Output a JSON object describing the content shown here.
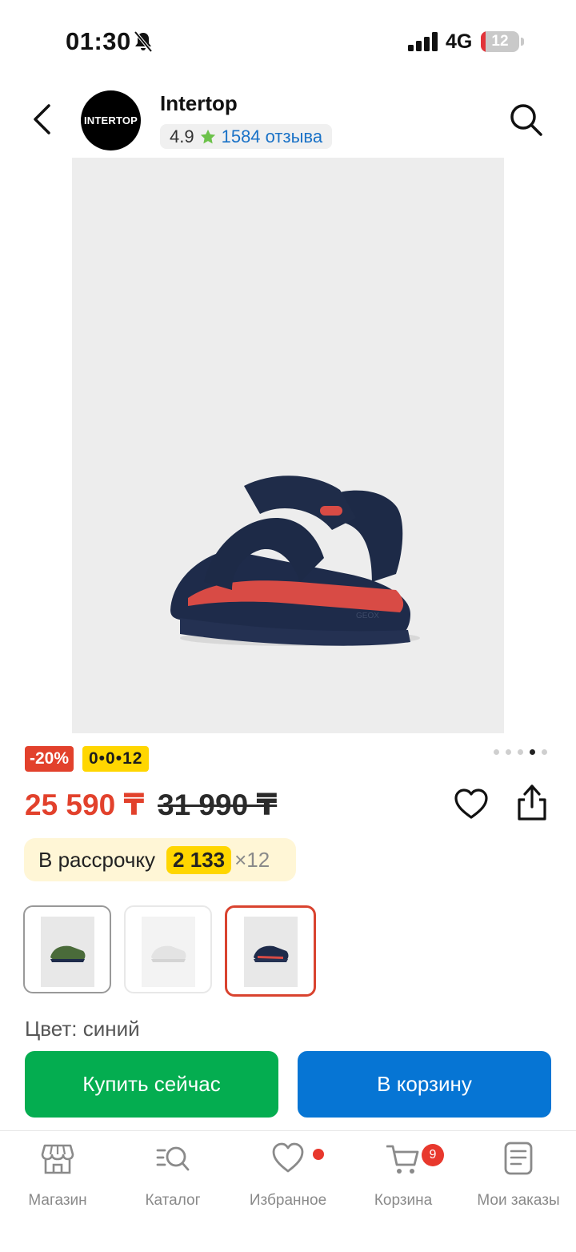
{
  "status_bar": {
    "time": "01:30",
    "network": "4G",
    "battery_level": "12",
    "battery_fraction": 0.12,
    "icons": [
      "bell-muted-icon",
      "signal-icon",
      "battery-icon"
    ]
  },
  "header": {
    "logo_text": "INTERTOP",
    "store_name": "Intertop",
    "rating": "4.9",
    "reviews": "1584 отзыва",
    "icons": [
      "back-arrow-icon",
      "star-icon",
      "search-icon"
    ]
  },
  "gallery": {
    "image_count": 5,
    "active_index": 3
  },
  "badges": {
    "discount": "-20%",
    "installment_plan": "0•0•12"
  },
  "price": {
    "current": "25 590 ₸",
    "old": "31 990 ₸"
  },
  "installment": {
    "label": "В рассрочку",
    "amount": "2 133",
    "multiplier": "×12"
  },
  "variants": {
    "colors": [
      "green",
      "white",
      "navy"
    ],
    "selected_index": 2
  },
  "color_label": "Цвет: синий",
  "actions": {
    "buy_now": "Купить сейчас",
    "add_to_cart": "В корзину"
  },
  "tabs": [
    {
      "label": "Магазин",
      "icon": "store-icon"
    },
    {
      "label": "Каталог",
      "icon": "catalog-search-icon"
    },
    {
      "label": "Избранное",
      "icon": "heart-icon"
    },
    {
      "label": "Корзина",
      "icon": "cart-icon",
      "badge": "9"
    },
    {
      "label": "Мои заказы",
      "icon": "orders-icon"
    }
  ],
  "colors": {
    "price_red": "#e2412c",
    "buy_green": "#04ad50",
    "cart_blue": "#0675d4",
    "link_blue": "#1a72c7",
    "installment_yellow": "#ffd600"
  }
}
